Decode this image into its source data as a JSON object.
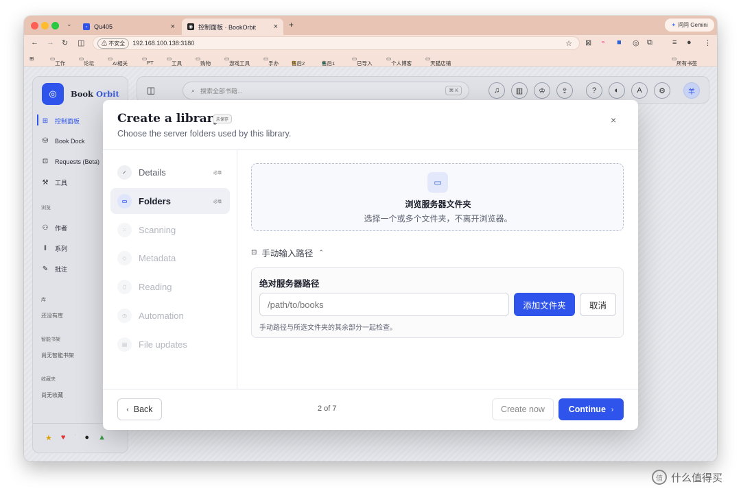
{
  "browser": {
    "tabs": [
      {
        "title": "Qu405"
      },
      {
        "title": "控制面板 · BookOrbit"
      }
    ],
    "new_tab": "+",
    "gemini_label": "问问 Gemini",
    "security_label": "不安全",
    "url": "192.168.100.138:3180",
    "bookmarks": [
      "工作",
      "论坛",
      "AI相关",
      "PT",
      "工具",
      "购物",
      "游戏工具",
      "手办",
      "售后2",
      "售后1",
      "已导入",
      "个人博客",
      "天猫店铺"
    ],
    "all_bookmarks": "所有书签"
  },
  "sidebar": {
    "brand_main": "Book",
    "brand_accent": "Orbit",
    "items": [
      {
        "label": "控制面板",
        "icon": "dashboard-icon"
      },
      {
        "label": "Book Dock",
        "icon": "dock-icon"
      },
      {
        "label": "Requests (Beta)",
        "icon": "requests-icon"
      },
      {
        "label": "工具",
        "icon": "wrench-icon"
      }
    ],
    "browse_heading": "浏览",
    "browse_items": [
      {
        "label": "作者",
        "icon": "users-icon"
      },
      {
        "label": "系列",
        "icon": "series-icon"
      },
      {
        "label": "批注",
        "icon": "annotate-icon"
      }
    ],
    "library_heading": "库",
    "library_empty": "还没有库",
    "smart_heading": "智能书架",
    "smart_empty": "尚无智能书架",
    "fav_heading": "收藏夹",
    "fav_empty": "尚无收藏"
  },
  "topbar": {
    "search_placeholder": "搜索全部书籍...",
    "shortcut": "⌘ K",
    "avatar": "羊"
  },
  "modal": {
    "title": "Create a library",
    "badge": "未保存",
    "subtitle": "Choose the server folders used by this library.",
    "steps": [
      {
        "label": "Details",
        "req": "必填",
        "state": "done"
      },
      {
        "label": "Folders",
        "req": "必填",
        "state": "active"
      },
      {
        "label": "Scanning",
        "req": "",
        "state": "pending"
      },
      {
        "label": "Metadata",
        "req": "",
        "state": "pending"
      },
      {
        "label": "Reading",
        "req": "",
        "state": "pending"
      },
      {
        "label": "Automation",
        "req": "",
        "state": "pending"
      },
      {
        "label": "File updates",
        "req": "",
        "state": "pending"
      }
    ],
    "browse_title": "浏览服务器文件夹",
    "browse_sub": "选择一个或多个文件夹，不离开浏览器。",
    "manual_toggle": "手动输入路径",
    "path_label": "绝对服务器路径",
    "path_placeholder": "/path/to/books",
    "add_button": "添加文件夹",
    "cancel_button": "取消",
    "hint": "手动路径与所选文件夹的其余部分一起检查。",
    "back": "Back",
    "pager": "2 of 7",
    "create_now": "Create now",
    "continue": "Continue"
  },
  "watermark": "什么值得买",
  "colors": {
    "accent": "#2f54eb",
    "tabbar": "#e8c4b4"
  }
}
